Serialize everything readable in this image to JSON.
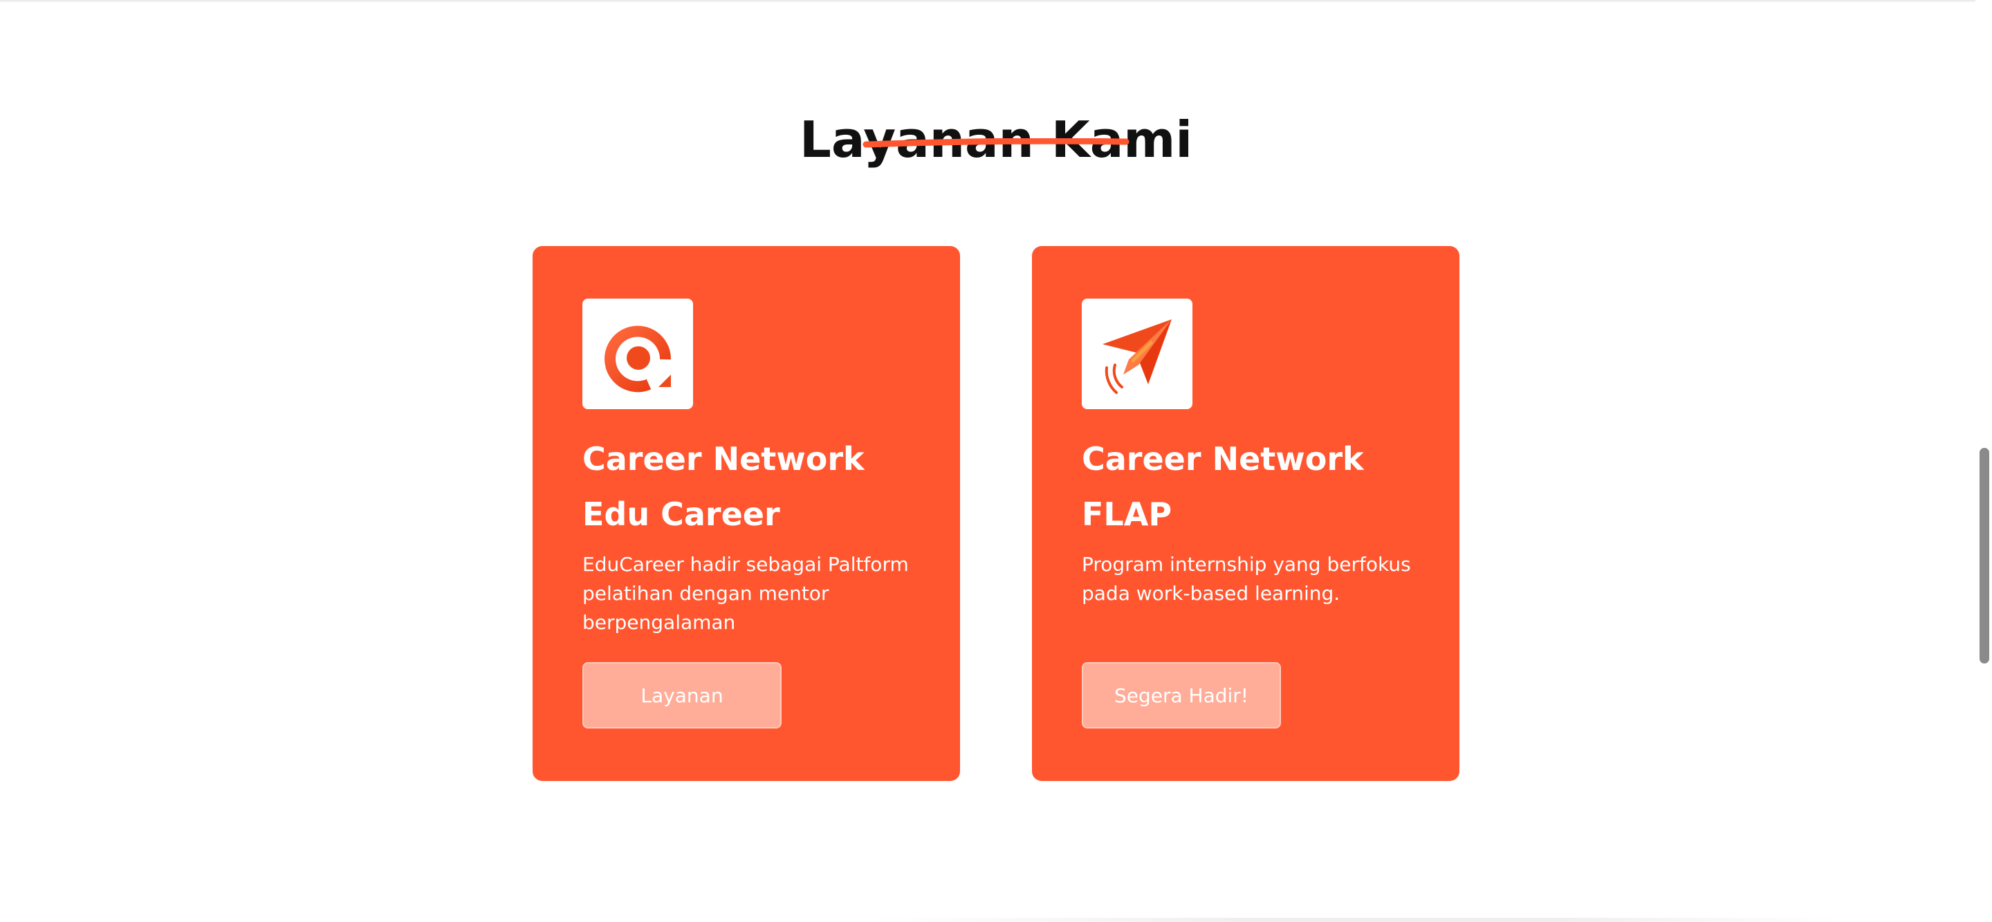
{
  "section": {
    "title": "Layanan Kami",
    "accent_color": "#ff5630"
  },
  "cards": [
    {
      "icon": "educareer-logo-icon",
      "title_line1": "Career Network",
      "title_line2": "Edu Career",
      "description": "EduCareer hadir sebagai Paltform pelatihan dengan mentor berpengalaman",
      "button_label": "Layanan"
    },
    {
      "icon": "paper-plane-logo-icon",
      "title_line1": "Career Network",
      "title_line2": "FLAP",
      "description": "Program internship yang berfokus pada work-based learning.",
      "button_label": "Segera Hadir!"
    }
  ],
  "colors": {
    "card_background": "#ff5630",
    "button_background": "#ffad98",
    "heading_text": "#111111"
  }
}
